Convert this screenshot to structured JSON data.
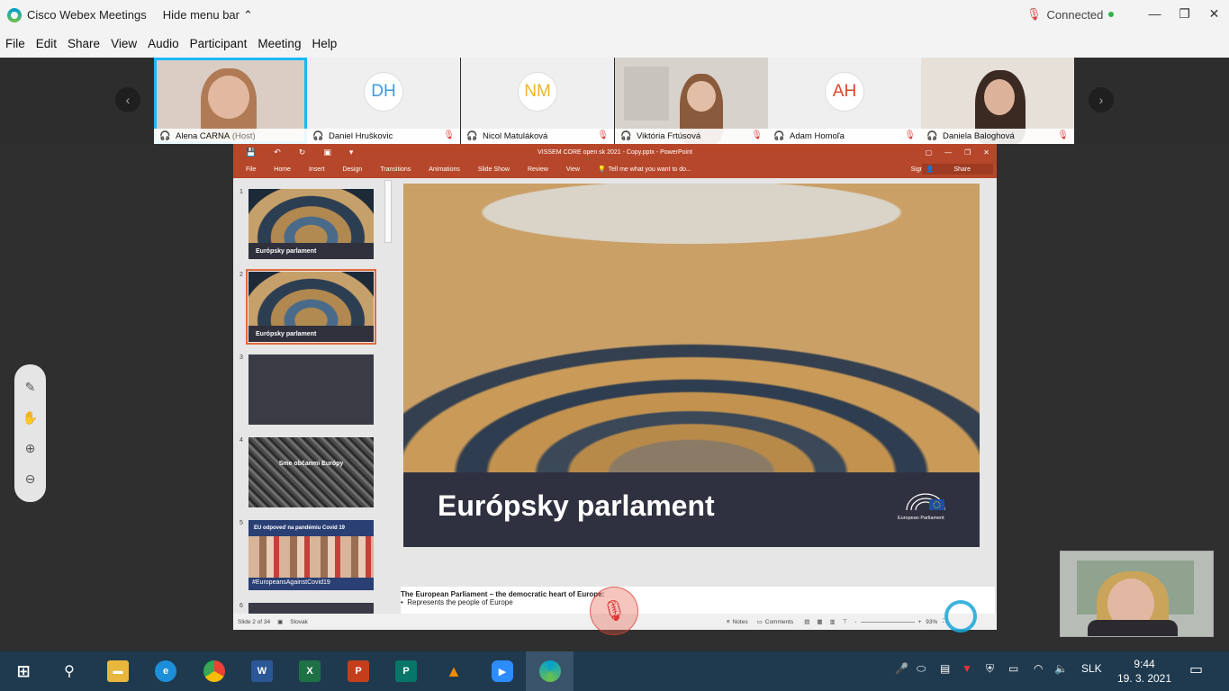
{
  "titlebar": {
    "app_name": "Cisco Webex Meetings",
    "hide_menu": "Hide menu bar",
    "status": "Connected"
  },
  "menu": [
    "File",
    "Edit",
    "Share",
    "View",
    "Audio",
    "Participant",
    "Meeting",
    "Help"
  ],
  "participants": [
    {
      "name": "Alena CARNA",
      "role": "(Host)",
      "video": true
    },
    {
      "name": "Daniel Hruškovic",
      "initials": "DH",
      "initials_color": "#3d9be0"
    },
    {
      "name": "Nicol Matuláková",
      "initials": "NM",
      "initials_color": "#f0b429"
    },
    {
      "name": "Viktória Frtúsová",
      "video": true
    },
    {
      "name": "Adam Homoľa",
      "initials": "AH",
      "initials_color": "#e0442c"
    },
    {
      "name": "Daniela Baloghová",
      "video": true
    }
  ],
  "ppt": {
    "doc_title": "VISSEM CORE open sk 2021 - Copy.pptx - PowerPoint",
    "tabs": [
      "File",
      "Home",
      "Insert",
      "Design",
      "Transitions",
      "Animations",
      "Slide Show",
      "Review",
      "View"
    ],
    "tell_me": "Tell me what you want to do...",
    "sign_in": "Sign in",
    "share": "Share",
    "thumbs": [
      {
        "num": "1",
        "caption": "Európsky parlament"
      },
      {
        "num": "2",
        "caption": "Európsky parlament"
      },
      {
        "num": "3",
        "caption": ""
      },
      {
        "num": "4",
        "caption": "Sme občanmi Európy"
      },
      {
        "num": "5",
        "caption": "EU odpoveď na pandémiu Covid 19",
        "tag": "#EuropeansAgainstCovid19"
      },
      {
        "num": "6",
        "caption": ""
      }
    ],
    "slide_title": "Európsky parlament",
    "ep_label": "European Parliament",
    "notes_line1": "The European Parliament – the democratic heart of Europe:",
    "notes_line2": "Represents the people of Europe",
    "status": {
      "slide": "Slide 2 of 34",
      "lang": "Slovak",
      "notes": "Notes",
      "comments": "Comments",
      "zoom": "93%"
    }
  },
  "taskbar": {
    "lang": "SLK",
    "time": "9:44",
    "date": "19. 3. 2021"
  }
}
